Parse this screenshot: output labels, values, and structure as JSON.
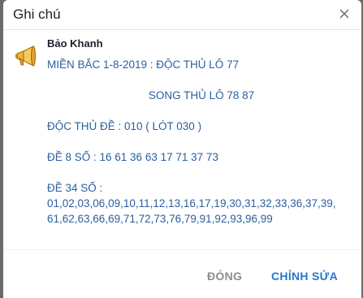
{
  "dialog": {
    "title": "Ghi chú"
  },
  "note": {
    "author": "Bảo Khanh",
    "lines": [
      "MIỀN BẮC 1-8-2019 : ĐỘC THỦ LÔ 77",
      "SONG THỦ LÔ 78 87",
      "ĐỘC THỦ ĐỀ : 010 ( LÓT 030 )",
      "ĐỀ 8 SỐ : 16 61 36 63 17 71 37 73",
      "ĐỀ 34 SỐ :",
      "01,02,03,06,09,10,11,12,13,16,17,19,30,31,32,33,36,37,39,",
      "61,62,63,66,69,71,72,73,76,79,91,92,93,96,99"
    ]
  },
  "footer": {
    "close_label": "ĐÓNG",
    "edit_label": "CHỈNH SỬA"
  },
  "icons": {
    "close": "close-icon",
    "avatar": "megaphone-icon"
  },
  "colors": {
    "text_blue": "#2b5f9e",
    "accent": "#2c75cf",
    "muted": "#8a8d91"
  }
}
